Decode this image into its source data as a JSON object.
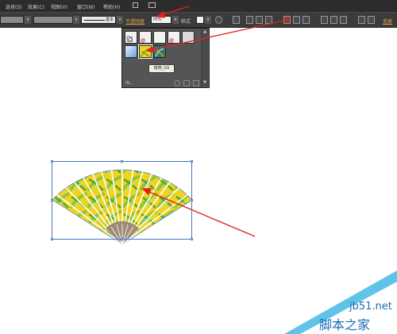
{
  "menu": {
    "items": [
      "选择(S)",
      "效果(C)",
      "视图(V)",
      "窗口(W)",
      "帮助(H)"
    ]
  },
  "toolbar": {
    "stroke_label": "基本",
    "opacity_label": "不透明度",
    "opacity_value": "70%",
    "style_label": "样式",
    "right_label": "变换"
  },
  "style_panel": {
    "tooltip": "植物_GS",
    "footer_label": "IN..."
  },
  "watermark": {
    "url": "jb51.net",
    "name": "脚本之家"
  },
  "colors": {
    "chrome_dark": "#2c2c2c",
    "toolbar": "#3b3b3b",
    "selection_blue": "#4a74c9",
    "arrow_red": "#e2231a",
    "fan_yellow": "#f5d21a",
    "fan_green": "#8cc63f",
    "fan_handle": "#a08a7a",
    "watermark_blue": "#1b6fb5"
  }
}
